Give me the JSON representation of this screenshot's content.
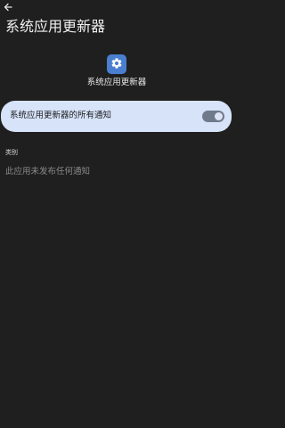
{
  "header": {
    "back_icon": "arrow-left-icon",
    "title": "系统应用更新器"
  },
  "app": {
    "icon": "gear-icon",
    "icon_color": "#4a7fd0",
    "name": "系统应用更新器"
  },
  "all_notifications": {
    "label": "系统应用更新器的所有通知",
    "enabled": true,
    "card_color": "#d6e3f8"
  },
  "categories": {
    "header": "类别",
    "empty_message": "此应用未发布任何通知"
  }
}
